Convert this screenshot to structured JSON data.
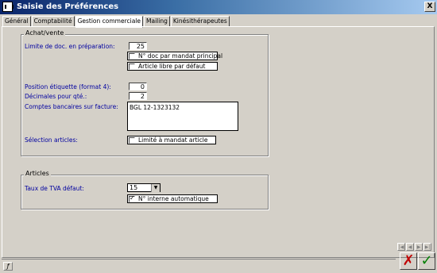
{
  "window": {
    "title": "Saisie des Préférences",
    "close_label": "X"
  },
  "tabs": [
    {
      "label": "Général"
    },
    {
      "label": "Comptabilité"
    },
    {
      "label": "Gestion commerciale"
    },
    {
      "label": "Mailing"
    },
    {
      "label": "Kinésithérapeutes"
    }
  ],
  "achat_vente": {
    "legend": "Achat/vente",
    "limite_label": "Limite de doc. en préparation:",
    "limite_value": "25",
    "chk_doc_mandat": "N° doc par mandat principal",
    "chk_article_libre": "Article libre par défaut",
    "position_label": "Position étiquette (format 4):",
    "position_value": "0",
    "decimales_label": "Décimales pour qté.:",
    "decimales_value": "2",
    "comptes_label": "Comptes bancaires sur facture:",
    "comptes_value": "BGL 12-1323132",
    "selection_label": "Sélection articles:",
    "chk_limite_mandat": "Limité à mandat article"
  },
  "articles": {
    "legend": "Articles",
    "tva_label": "Taux de TVA défaut:",
    "tva_value": "15",
    "chk_num_interne": "N° interne automatique"
  },
  "nav": {
    "first": "|◀",
    "prev": "◀",
    "next": "▶",
    "last": "▶|"
  },
  "footer": {
    "cancel_label": "✗",
    "ok_label": "✓",
    "status_icon": "ƒ"
  },
  "colors": {
    "title_bar_start": "#0a246a",
    "label_blue": "#0000a0",
    "cancel": "#c00000",
    "ok": "#008000"
  }
}
